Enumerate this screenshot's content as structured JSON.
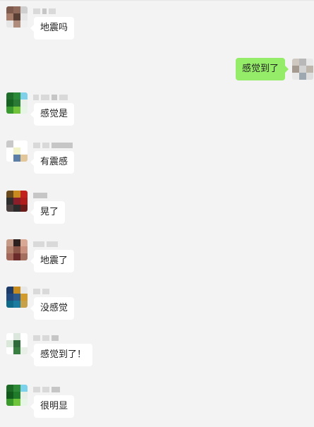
{
  "messages": [
    {
      "dir": "received",
      "text": "地震吗",
      "avatar": [
        "#7d5a4c",
        "#8f6a5a",
        "#cfcfcf",
        "#a77e6b",
        "#5a3f35",
        "#e7e7e7",
        "#e5e5e5",
        "#b08c7d",
        "#efefef"
      ]
    },
    {
      "dir": "sent",
      "text": "感觉到了",
      "avatar": [
        "#cfc8c0",
        "#b8b8b8",
        "#e8e8e8",
        "#a59a8f",
        "#d3d3d3",
        "#bdb6ad",
        "#e8e8e8",
        "#9ea8b0",
        "#dedede"
      ]
    },
    {
      "dir": "received",
      "text": "感觉是",
      "avatar": [
        "#1f6d2a",
        "#2b8a3a",
        "#7fd0e8",
        "#166321",
        "#2a7a35",
        "#e9f0e9",
        "#3b9a2f",
        "#72c23a",
        "#e6f5e6"
      ]
    },
    {
      "dir": "received",
      "text": "有震感",
      "avatar": [
        "#c9c9c9",
        "#ffffff",
        "#ffffff",
        "#ffffff",
        "#f2f2c8",
        "#ffffff",
        "#ffffff",
        "#5b7fa6",
        "#e2c79a"
      ]
    },
    {
      "dir": "received",
      "text": "晃了",
      "avatar": [
        "#6a4a1c",
        "#c88a1e",
        "#c21f1f",
        "#2e2e2e",
        "#8a1f2a",
        "#b01c1c",
        "#4a3f3f",
        "#2b2b2b",
        "#6b1a1a"
      ]
    },
    {
      "dir": "received",
      "text": "地震了",
      "avatar": [
        "#c59a86",
        "#2d2220",
        "#d9a895",
        "#b3806c",
        "#8a5546",
        "#c9917d",
        "#a3675a",
        "#6b2b2b",
        "#a56f5f"
      ]
    },
    {
      "dir": "received",
      "text": "没感觉",
      "avatar": [
        "#1d3b6a",
        "#c68b1d",
        "#e7e7e7",
        "#21497d",
        "#2e5a8a",
        "#d19a2a",
        "#0f6a8a",
        "#1a7aa0",
        "#c7a04a"
      ]
    },
    {
      "dir": "received",
      "text": "感觉到了！",
      "avatar": [
        "#ffffff",
        "#dbe7dc",
        "#ffffff",
        "#d9e8d9",
        "#2f6b3a",
        "#ffffff",
        "#ffffff",
        "#3a7f42",
        "#e7efe7"
      ]
    },
    {
      "dir": "received",
      "text": "很明显",
      "avatar": [
        "#1c6a25",
        "#2e8a36",
        "#7bd2ea",
        "#125a1c",
        "#1f7a2a",
        "#e7efe7",
        "#3a9a2c",
        "#6ec43a",
        "#e6f5e6"
      ]
    }
  ]
}
